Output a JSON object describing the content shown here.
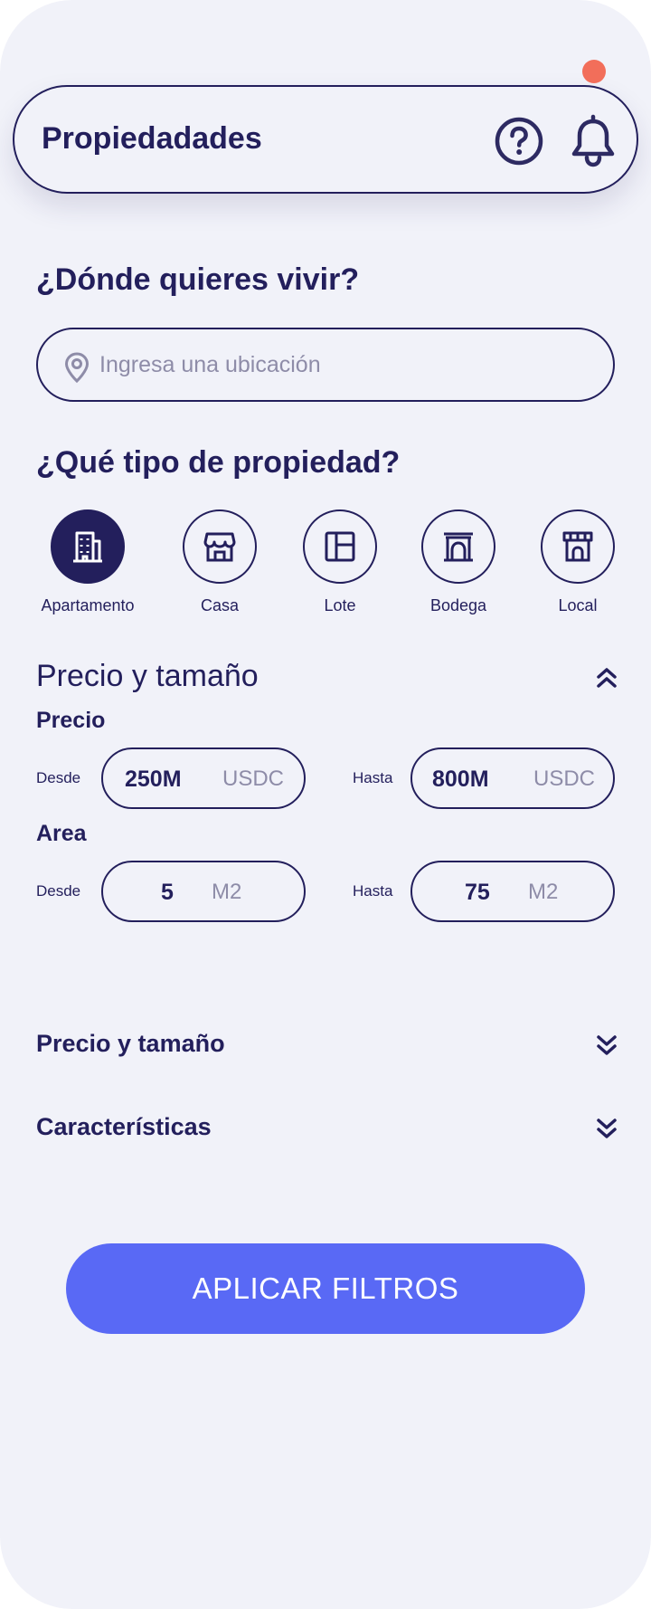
{
  "header": {
    "title": "Propiedadades",
    "help_icon": "question-circle-icon",
    "bell_icon": "bell-icon"
  },
  "location": {
    "title": "¿Dónde quieres vivir?",
    "placeholder": "Ingresa una ubicación",
    "value": ""
  },
  "property_type": {
    "title": "¿Qué tipo de propiedad?",
    "items": [
      {
        "label": "Apartamento",
        "icon": "building-icon",
        "selected": true
      },
      {
        "label": "Casa",
        "icon": "store-icon",
        "selected": false
      },
      {
        "label": "Lote",
        "icon": "layout-icon",
        "selected": false
      },
      {
        "label": "Bodega",
        "icon": "warehouse-icon",
        "selected": false
      },
      {
        "label": "Local",
        "icon": "shop-icon",
        "selected": false
      }
    ]
  },
  "price_size": {
    "title": "Precio y tamaño",
    "price": {
      "label": "Precio",
      "from_label": "Desde",
      "from_value": "250M",
      "from_unit": "USDC",
      "to_label": "Hasta",
      "to_value": "800M",
      "to_unit": "USDC"
    },
    "area": {
      "label": "Area",
      "from_label": "Desde",
      "from_value": "5",
      "from_unit": "M2",
      "to_label": "Hasta",
      "to_value": "75",
      "to_unit": "M2"
    }
  },
  "collapsed_sections": [
    {
      "title": "Precio y tamaño"
    },
    {
      "title": "Características"
    }
  ],
  "apply_button": {
    "label": "APLICAR FILTROS"
  },
  "colors": {
    "primary": "#231f5c",
    "accent": "#5969f5",
    "notification": "#f26e5a",
    "background": "#f1f2f9",
    "muted": "#8e8ca8"
  }
}
